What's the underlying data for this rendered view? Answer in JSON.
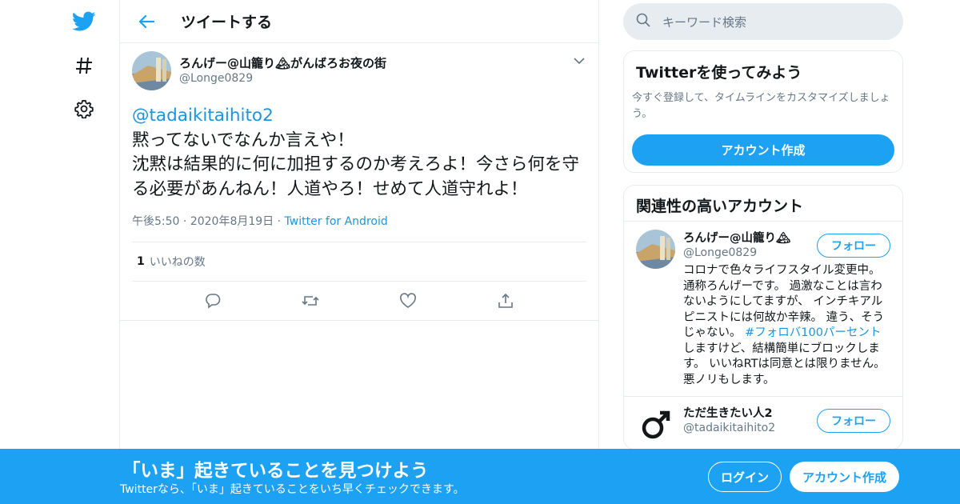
{
  "nav": {
    "logo_icon": "twitter-bird-icon",
    "explore_icon": "hashtag-icon",
    "settings_icon": "gear-icon"
  },
  "header": {
    "title": "ツイートする"
  },
  "tweet": {
    "display_name": "ろんげー@山籠り🏔がんばろお夜の街",
    "handle": "@Longe0829",
    "mention": "@tadaikitaihito2",
    "lines": [
      "黙ってないでなんか言えや！",
      "沈黙は結果的に何に加担するのか考えろよ！今さら何を守る必要があんねん！人道やろ！せめて人道守れよ！"
    ],
    "time": "午後5:50",
    "date": "2020年8月19日",
    "source": "Twitter for Android",
    "like_count": "1",
    "like_label": "いいねの数"
  },
  "search": {
    "placeholder": "キーワード検索"
  },
  "signup_card": {
    "title": "Twitterを使ってみよう",
    "desc": "今すぐ登録して、タイムラインをカスタマイズしましょう。",
    "button": "アカウント作成"
  },
  "related": {
    "title": "関連性の高いアカウント",
    "follow_label": "フォロー",
    "accounts": [
      {
        "name": "ろんげー@山籠り🏔",
        "handle": "@Longe0829",
        "bio_a": "コロナで色々ライフスタイル変更中。通称ろんげーです。 過激なことは言わないようにしてますが、 インチキアルピニストには何故か辛辣。 違う、そうじゃない。 ",
        "bio_tag": "#フォロバ100パーセント",
        "bio_b": " しますけど、結構簡単にブロックします。 いいねRTは同意とは限りません。 悪ノリもします。"
      },
      {
        "name": "ただ生きたい人2",
        "handle": "@tadaikitaihito2"
      }
    ]
  },
  "banner": {
    "headline": "「いま」起きていることを見つけよう",
    "sub": "Twitterなら、「いま」起きていることをいち早くチェックできます。",
    "login": "ログイン",
    "signup": "アカウント作成"
  },
  "colors": {
    "brand": "#1da1f2",
    "link": "#1b95e0",
    "muted": "#657786",
    "border": "#e6ecf0"
  }
}
